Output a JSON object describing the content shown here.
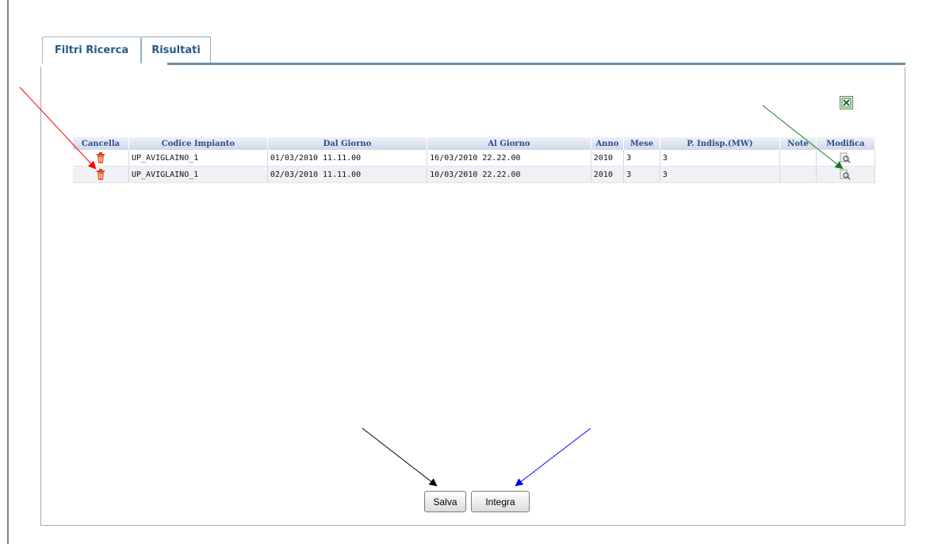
{
  "tabs": [
    {
      "label": "Filtri Ricerca"
    },
    {
      "label": "Risultati"
    }
  ],
  "export_icon": "excel-icon",
  "table": {
    "headers": [
      "Cancella",
      "Codice Impianto",
      "Dal Giorno",
      "Al Giorno",
      "Anno",
      "Mese",
      "P. Indisp.(MW)",
      "Note",
      "Modifica"
    ],
    "rows": [
      {
        "codice": "UP_AVIGLAINO_1",
        "dal": "01/03/2010 11.11.00",
        "al": "16/03/2010 22.22.00",
        "anno": "2010",
        "mese": "3",
        "pindisp": "3",
        "note": ""
      },
      {
        "codice": "UP_AVIGLAINO_1",
        "dal": "02/03/2010 11.11.00",
        "al": "10/03/2010 22.22.00",
        "anno": "2010",
        "mese": "3",
        "pindisp": "3",
        "note": ""
      }
    ]
  },
  "buttons": {
    "salva": "Salva",
    "integra": "Integra"
  },
  "colors": {
    "arrow_red": "#ff0000",
    "arrow_green": "#1a7a1a",
    "arrow_black": "#000000",
    "arrow_blue": "#0000ff",
    "header_text": "#2a4f8a",
    "tab_text": "#245a87"
  }
}
